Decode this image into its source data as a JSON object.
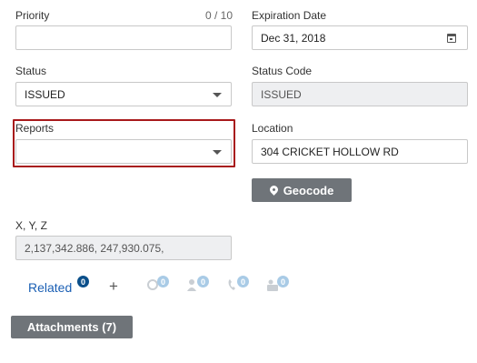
{
  "priority": {
    "label": "Priority",
    "counter": "0 / 10",
    "value": ""
  },
  "expiration": {
    "label": "Expiration Date",
    "value": "Dec 31, 2018",
    "icon": "calendar-icon"
  },
  "status": {
    "label": "Status",
    "value": "ISSUED"
  },
  "status_code": {
    "label": "Status Code",
    "value": "ISSUED"
  },
  "reports": {
    "label": "Reports",
    "value": ""
  },
  "location": {
    "label": "Location",
    "value": "304 CRICKET HOLLOW RD"
  },
  "geocode": {
    "label": "Geocode",
    "icon": "map-pin-icon"
  },
  "xyz": {
    "label": "X, Y, Z",
    "value": "2,137,342.886, 247,930.075,"
  },
  "related": {
    "label": "Related",
    "count": "0",
    "add_icon": "plus-icon",
    "icons": [
      {
        "name": "search-related-icon",
        "count": "0"
      },
      {
        "name": "people-related-icon",
        "count": "0"
      },
      {
        "name": "phone-related-icon",
        "count": "0"
      },
      {
        "name": "group-related-icon",
        "count": "0"
      }
    ]
  },
  "attachments": {
    "label": "Attachments (7)"
  },
  "colors": {
    "highlight": "#a8191b",
    "button": "#6f7479",
    "link": "#1a5fb4",
    "badge": "#0b4f8a"
  }
}
